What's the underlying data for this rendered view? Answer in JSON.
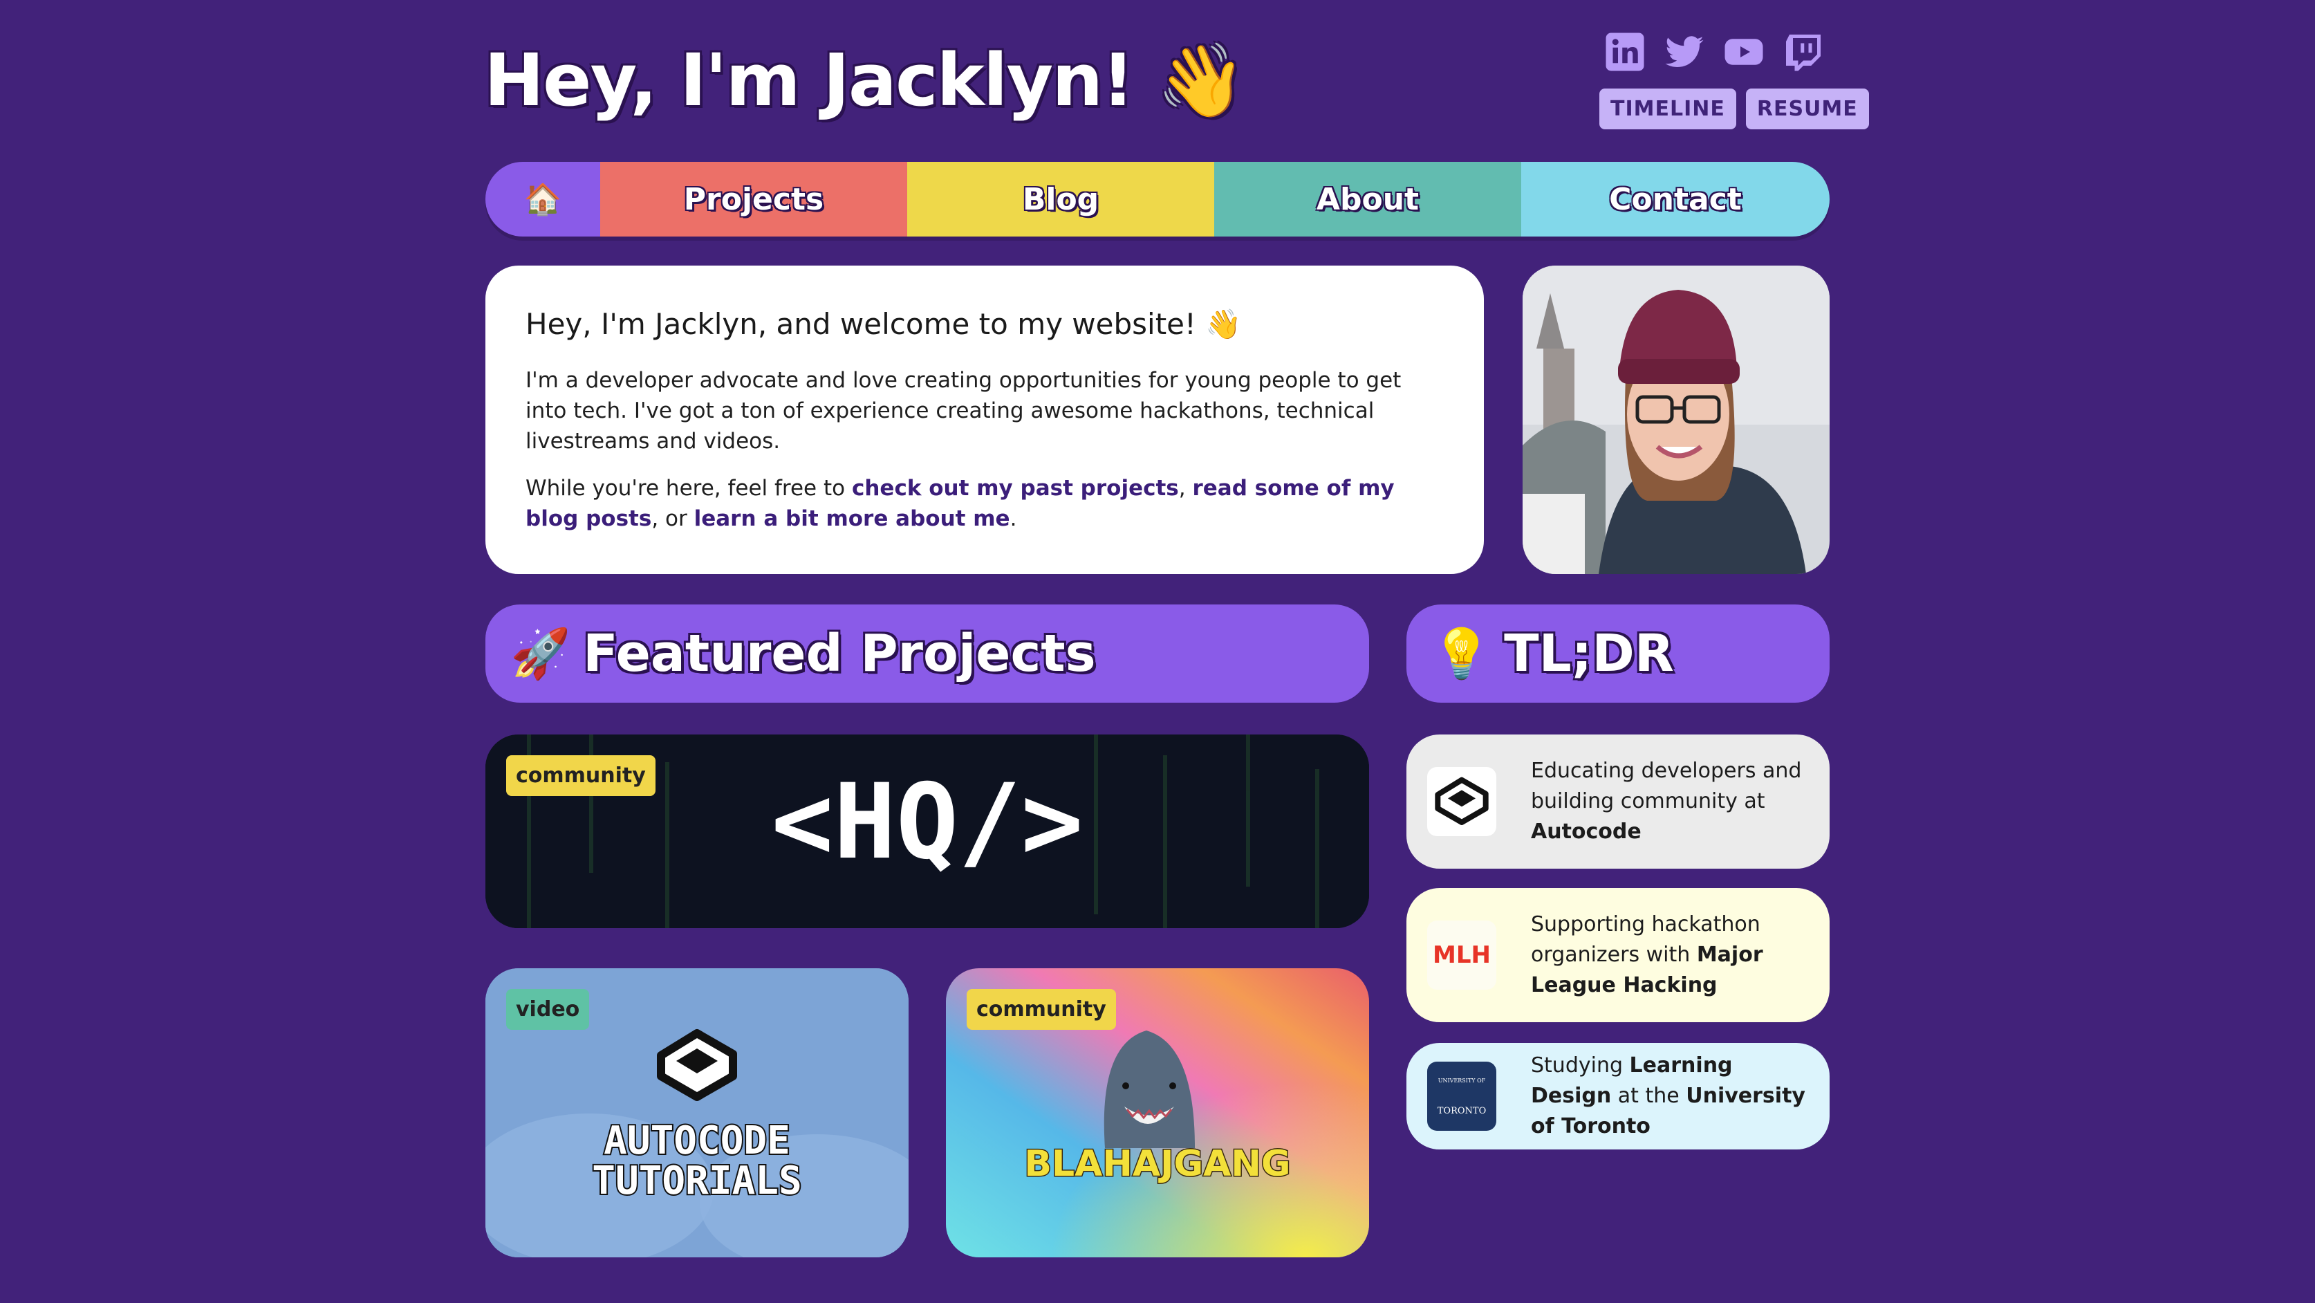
{
  "header": {
    "title": "Hey, I'm Jacklyn! 👋",
    "social_icons": [
      "linkedin-icon",
      "twitter-icon",
      "youtube-icon",
      "twitch-icon"
    ],
    "links": [
      "TIMELINE",
      "RESUME"
    ]
  },
  "nav": {
    "home_icon": "🏠",
    "items": [
      "Projects",
      "Blog",
      "About",
      "Contact"
    ],
    "colors": [
      "#8a5be8",
      "#ec7068",
      "#eed84a",
      "#62bcb0",
      "#82d8ea"
    ]
  },
  "welcome": {
    "heading": "Hey, I'm Jacklyn, and welcome to my website! 👋",
    "paragraph1": "I'm a developer advocate and love creating opportunities for young people to get into tech. I've got a ton of experience creating awesome hackathons, technical livestreams and videos.",
    "p2_prefix": "While you're here, feel free to ",
    "link_projects": "check out my past projects",
    "p2_sep1": ", ",
    "link_blog": "read some of my blog posts",
    "p2_sep2": ", or ",
    "link_about": "learn a bit more about me",
    "p2_suffix": "."
  },
  "featured": {
    "emoji": "🚀",
    "title": "Featured Projects",
    "cards": [
      {
        "tag": "community",
        "logo_text": "<HQ/>"
      },
      {
        "tag": "video",
        "title_line1": "AUTOCODE",
        "title_line2": "TUTORIALS"
      },
      {
        "tag": "community",
        "title": "BLAHAJGANG"
      }
    ]
  },
  "tldr": {
    "emoji": "💡",
    "title": "TL;DR",
    "items": [
      {
        "pre": "Educating developers and building community at ",
        "bold1": "Autocode",
        "mid": "",
        "bold2": "",
        "post": ""
      },
      {
        "pre": "Supporting hackathon organizers with ",
        "bold1": "Major League Hacking",
        "mid": "",
        "bold2": "",
        "post": ""
      },
      {
        "pre": "Studying ",
        "bold1": "Learning Design",
        "mid": " at the ",
        "bold2": "University of Toronto",
        "post": ""
      }
    ],
    "logos": {
      "mlh": "MLH",
      "uoft_line1": "UNIVERSITY OF",
      "uoft_line2": "TORONTO"
    }
  },
  "colors": {
    "background": "#42227a",
    "accent": "#8a5be8",
    "link": "#3b1e7a"
  }
}
